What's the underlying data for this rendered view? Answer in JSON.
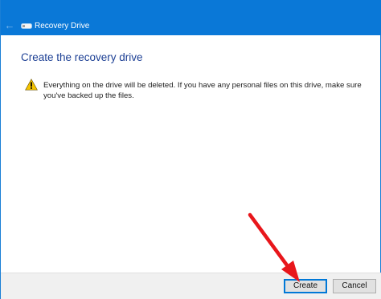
{
  "window": {
    "title": "Recovery Drive",
    "icons": {
      "back": "back-arrow-icon",
      "app": "drive-icon"
    }
  },
  "content": {
    "heading": "Create the recovery drive",
    "warning_icon": "warning-icon",
    "warning_text": "Everything on the drive will be deleted. If you have any personal files on this drive, make sure you've backed up the files."
  },
  "footer": {
    "create_label": "Create",
    "cancel_label": "Cancel"
  },
  "annotation": {
    "icon": "red-arrow-pointer",
    "color": "#e8161b"
  },
  "colors": {
    "titlebar": "#0a78d7",
    "heading": "#1c3f94",
    "focus": "#0078d7"
  }
}
